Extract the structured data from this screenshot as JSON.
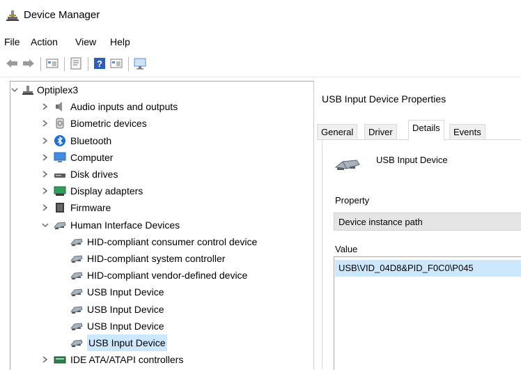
{
  "window": {
    "title": "Device Manager"
  },
  "menu": [
    "File",
    "Action",
    "View",
    "Help"
  ],
  "toolbar": [
    "back-icon",
    "forward-icon",
    "show-hidden-icon",
    "properties-icon",
    "help-icon",
    "update-driver-icon",
    "scan-hardware-icon"
  ],
  "tree": {
    "root": "Optiplex3",
    "categories": [
      "Audio inputs and outputs",
      "Biometric devices",
      "Bluetooth",
      "Computer",
      "Disk drives",
      "Display adapters",
      "Firmware",
      "Human Interface Devices"
    ],
    "hid_children": [
      "HID-compliant consumer control device",
      "HID-compliant system controller",
      "HID-compliant vendor-defined device",
      "USB Input Device",
      "USB Input Device",
      "USB Input Device",
      "USB Input Device"
    ],
    "after": "IDE ATA/ATAPI controllers"
  },
  "dialog": {
    "title": "USB Input Device Properties",
    "tabs": [
      "General",
      "Driver",
      "Details",
      "Events"
    ],
    "active_tab": "Details",
    "device_name": "USB Input Device",
    "property_label": "Property",
    "property_value": "Device instance path",
    "value_label": "Value",
    "value": "USB\\VID_04D8&PID_F0C0\\P045"
  },
  "colors": {
    "selection": "#cce8ff",
    "border": "#a9a9a9",
    "accent": "#0078d7"
  }
}
